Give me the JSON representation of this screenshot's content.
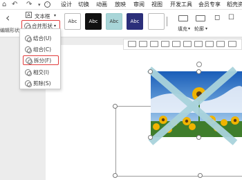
{
  "tabs": [
    "设计",
    "切换",
    "动画",
    "放映",
    "审阅",
    "视图",
    "开发工具",
    "会员专享",
    "稻壳资"
  ],
  "ribbon": {
    "text_box_label": "文本框",
    "edit_shape_label": "编辑形状",
    "merge_shape_label": "合并形状",
    "fill_label": "填充",
    "outline_label": "轮廓"
  },
  "style_boxes": [
    "Abc",
    "Abc",
    "Abc",
    "Abc"
  ],
  "menu": {
    "items": [
      "结合(U)",
      "组合(C)",
      "拆分(F)",
      "相交(I)",
      "剪除(S)"
    ]
  },
  "colors": {
    "style_black": "#111111",
    "style_teal": "#a8d5d8",
    "style_navy": "#2b2f7a",
    "highlight_red": "#e03b3b",
    "x_band": "#a9d3dc"
  }
}
